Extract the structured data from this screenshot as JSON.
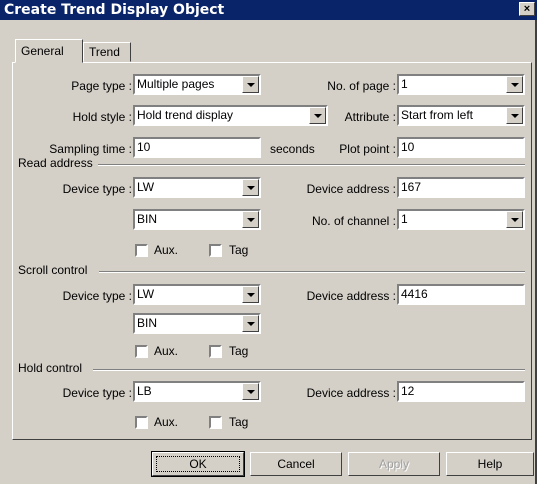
{
  "window": {
    "title": "Create Trend Display  Object",
    "close_label": "×"
  },
  "tabs": [
    {
      "label": "General"
    },
    {
      "label": "Trend"
    }
  ],
  "general": {
    "page_type": {
      "label": "Page type :",
      "value": "Multiple pages"
    },
    "no_of_page": {
      "label": "No. of page :",
      "value": "1"
    },
    "hold_style": {
      "label": "Hold style :",
      "value": "Hold trend display"
    },
    "attribute": {
      "label": "Attribute :",
      "value": "Start from left"
    },
    "sampling_time": {
      "label": "Sampling time :",
      "value": "10",
      "unit": "seconds"
    },
    "plot_point": {
      "label": "Plot point :",
      "value": "10"
    }
  },
  "read_address": {
    "title": "Read address",
    "device_type_label": "Device type :",
    "device_type": "LW",
    "format": "BIN",
    "device_address_label": "Device address :",
    "device_address": "167",
    "channel_label": "No. of channel :",
    "channel": "1",
    "aux_label": "Aux.",
    "tag_label": "Tag"
  },
  "scroll_control": {
    "title": "Scroll control",
    "device_type_label": "Device type :",
    "device_type": "LW",
    "format": "BIN",
    "device_address_label": "Device address :",
    "device_address": "4416",
    "aux_label": "Aux.",
    "tag_label": "Tag"
  },
  "hold_control": {
    "title": "Hold control",
    "device_type_label": "Device type :",
    "device_type": "LB",
    "device_address_label": "Device address :",
    "device_address": "12",
    "aux_label": "Aux.",
    "tag_label": "Tag"
  },
  "buttons": {
    "ok": "OK",
    "cancel": "Cancel",
    "apply": "Apply",
    "help": "Help"
  }
}
